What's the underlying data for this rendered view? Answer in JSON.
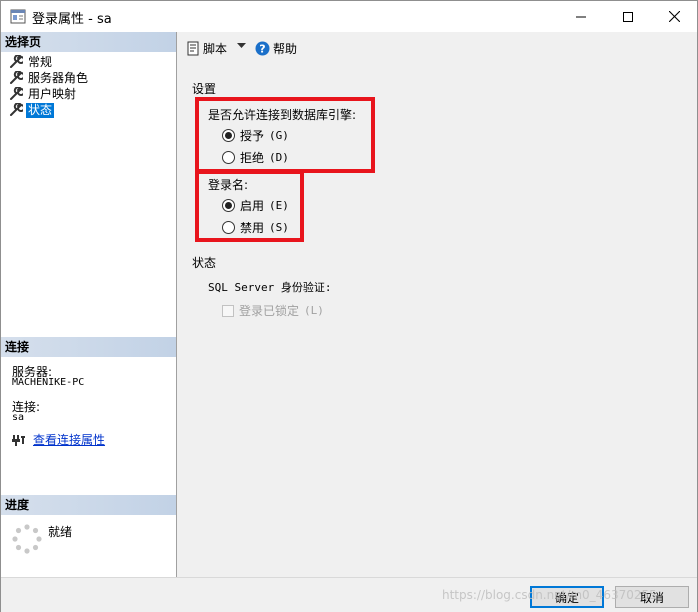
{
  "window": {
    "title": "登录属性 - sa"
  },
  "left": {
    "select_page_header": "选择页",
    "pages": [
      {
        "label": "常规"
      },
      {
        "label": "服务器角色"
      },
      {
        "label": "用户映射"
      },
      {
        "label": "状态"
      }
    ],
    "connection_header": "连接",
    "server_label": "服务器:",
    "server_value": "MACHENIKE-PC",
    "connection_label": "连接:",
    "connection_value": "sa",
    "view_connection_link": "查看连接属性",
    "progress_header": "进度",
    "progress_status": "就绪"
  },
  "toolbar": {
    "script_label": "脚本",
    "help_label": "帮助"
  },
  "settings": {
    "section_label": "设置",
    "db_engine_group": "是否允许连接到数据库引擎:",
    "grant_label": "授予",
    "grant_key": "(G)",
    "deny_label": "拒绝",
    "deny_key": "(D)",
    "login_group": "登录名:",
    "enable_label": "启用",
    "enable_key": "(E)",
    "disable_label": "禁用",
    "disable_key": "(S)",
    "status_label": "状态",
    "sql_auth_label": "SQL Server 身份验证:",
    "locked_label": "登录已锁定",
    "locked_key": "(L)"
  },
  "buttons": {
    "ok": "确定",
    "cancel": "取消"
  },
  "watermark": "https://blog.csdn.net/m0_46370255",
  "colors": {
    "selected": "#0078d7",
    "highlight_box": "#e8141c",
    "section_header": "#c8d6e9"
  }
}
